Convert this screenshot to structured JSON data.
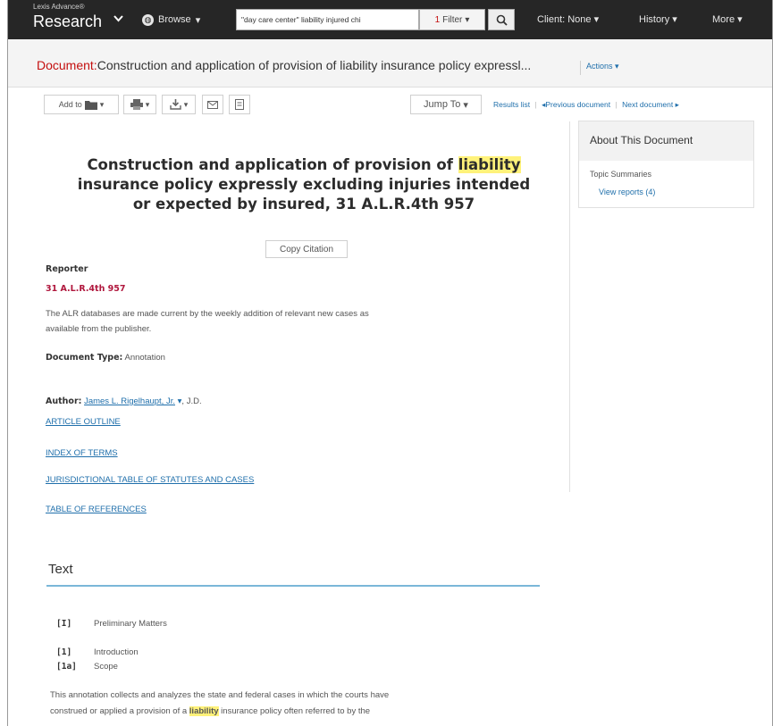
{
  "topnav": {
    "brand_small": "Lexis Advance®",
    "brand_big": "Research",
    "browse_label": "Browse",
    "search_query": "\"day care center\" liability injured chi",
    "filter_count": "1",
    "filter_label": "Filter",
    "client_label": "Client: None",
    "history_label": "History",
    "more_label": "More"
  },
  "docbar": {
    "doc_label": "Document:",
    "doc_title": "Construction and application of provision of liability insurance policy expressl...",
    "actions_label": "Actions"
  },
  "toolbar": {
    "add_to_label": "Add to",
    "jump_to_label": "Jump To",
    "results_list": "Results list",
    "previous_document": "Previous document",
    "next_document": "Next document"
  },
  "document": {
    "title_before": "Construction and application of provision of ",
    "title_highlight": "liability",
    "title_after": " insurance policy expressly excluding injuries intended or expected by insured, 31 A.L.R.4th 957",
    "copy_citation": "Copy Citation",
    "reporter_label": "Reporter",
    "reporter_value": "31 A.L.R.4th 957",
    "currency_note_line1": "The ALR databases are made current by the weekly addition of relevant new cases as",
    "currency_note_line2": "available from the publisher.",
    "doc_type_label": "Document Type:",
    "doc_type_value": "Annotation",
    "author_label": "Author:",
    "author_name": "James L. Rigelhaupt, Jr.",
    "author_suffix": ", J.D.",
    "links": [
      "ARTICLE OUTLINE",
      "INDEX OF TERMS",
      "JURISDICTIONAL TABLE OF STATUTES AND CASES",
      "TABLE OF REFERENCES"
    ]
  },
  "sidebar": {
    "about_title": "About This Document",
    "topic_summaries": "Topic Summaries",
    "view_reports": "View reports (4)"
  },
  "text_section": {
    "heading": "Text",
    "toc": [
      {
        "num": "[I]",
        "label": "Preliminary Matters"
      },
      {
        "num": "[1]",
        "label": "Introduction"
      },
      {
        "num": "[1a]",
        "label": "Scope"
      }
    ],
    "para_line1": "This annotation collects and analyzes the state and federal cases in which the courts have",
    "para_line2_before": "construed or applied a provision of a ",
    "para_line2_bold": "liability",
    "para_line2_after": " insurance policy often referred to by the"
  },
  "colors": {
    "nav_bg": "#262626",
    "doc_label_red": "#c40f0f",
    "link_blue": "#1f6fab",
    "highlight_yellow": "#fff27a",
    "rule_blue": "#7ab7d8"
  }
}
